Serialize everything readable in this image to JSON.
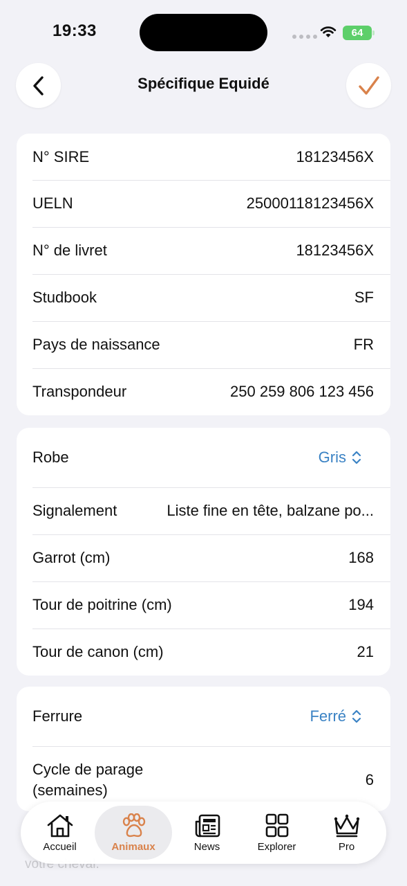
{
  "status_bar": {
    "time": "19:33",
    "battery": "64"
  },
  "header": {
    "title": "Spécifique Equidé"
  },
  "identification": [
    {
      "label": "N° SIRE",
      "value": "18123456X"
    },
    {
      "label": "UELN",
      "value": "25000118123456X"
    },
    {
      "label": "N° de livret",
      "value": "18123456X"
    },
    {
      "label": "Studbook",
      "value": "SF"
    },
    {
      "label": "Pays de naissance",
      "value": "FR"
    },
    {
      "label": "Transpondeur",
      "value": "250 259 806 123 456"
    }
  ],
  "physical": {
    "robe": {
      "label": "Robe",
      "value": "Gris"
    },
    "signalement": {
      "label": "Signalement",
      "value": "Liste fine en tête, balzane po..."
    },
    "garrot": {
      "label": "Garrot (cm)",
      "value": "168"
    },
    "poitrine": {
      "label": "Tour de poitrine (cm)",
      "value": "194"
    },
    "canon": {
      "label": "Tour de canon (cm)",
      "value": "21"
    }
  },
  "hoof": {
    "ferrure": {
      "label": "Ferrure",
      "value": "Ferré"
    },
    "cycle": {
      "label_line1": "Cycle de parage",
      "label_line2": "(semaines)",
      "value": "6"
    }
  },
  "background_text": "votre cheval.",
  "tabs": [
    {
      "label": "Accueil",
      "icon": "home-icon"
    },
    {
      "label": "Animaux",
      "icon": "paw-icon"
    },
    {
      "label": "News",
      "icon": "newspaper-icon"
    },
    {
      "label": "Explorer",
      "icon": "grid-icon"
    },
    {
      "label": "Pro",
      "icon": "crown-icon"
    }
  ],
  "colors": {
    "accent": "#d9824b",
    "picker_blue": "#3a82c4",
    "background": "#f2f2f7"
  }
}
